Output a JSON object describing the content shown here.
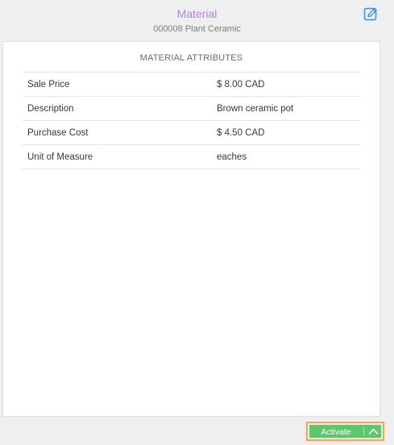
{
  "header": {
    "title": "Material",
    "subtitle": "000008 Plant Ceramic",
    "edit_icon": "edit-icon"
  },
  "section": {
    "title": "MATERIAL ATTRIBUTES"
  },
  "attributes": [
    {
      "label": "Sale Price",
      "value": "$ 8.00 CAD"
    },
    {
      "label": "Description",
      "value": "Brown ceramic pot"
    },
    {
      "label": "Purchase Cost",
      "value": "$ 4.50 CAD"
    },
    {
      "label": "Unit of Measure",
      "value": "eaches"
    }
  ],
  "footer": {
    "activate_label": "Activate",
    "expand_icon": "chevron-up-icon"
  },
  "colors": {
    "accent_title": "#b57ee8",
    "edit_icon": "#3a8fd8",
    "activate_button": "#5bc86c",
    "highlight_border": "#f4a84b"
  }
}
